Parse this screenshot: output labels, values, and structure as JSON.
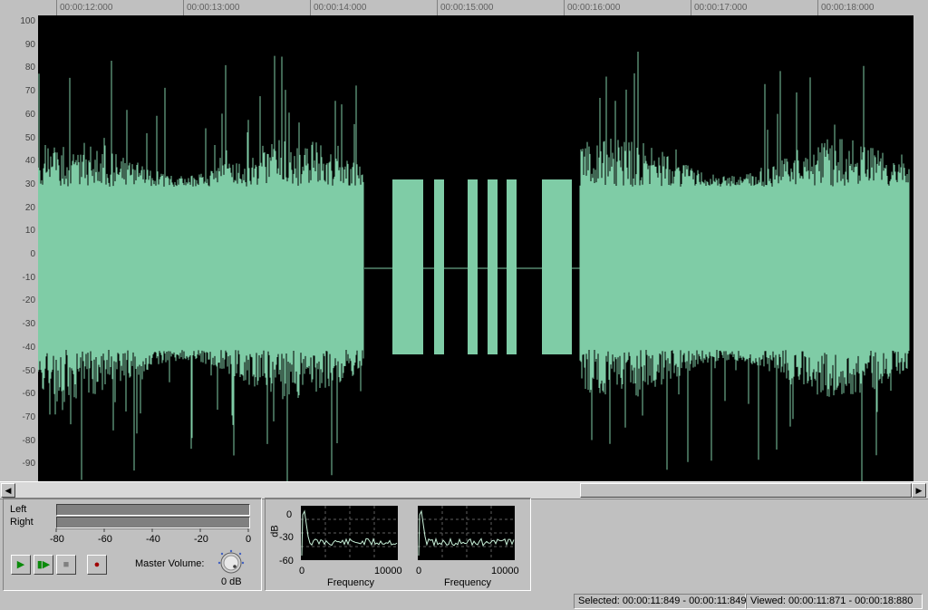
{
  "ruler": {
    "times": [
      "00:00:12:000",
      "00:00:13:000",
      "00:00:14:000",
      "00:00:15:000",
      "00:00:16:000",
      "00:00:17:000",
      "00:00:18:000"
    ]
  },
  "yaxis": {
    "labels": [
      "100",
      "90",
      "80",
      "70",
      "60",
      "50",
      "40",
      "30",
      "20",
      "10",
      "0",
      "-10",
      "-20",
      "-30",
      "-40",
      "-50",
      "-60",
      "-70",
      "-80",
      "-90"
    ]
  },
  "colors": {
    "waveform": "#7fcca6",
    "plot_background": "#000000",
    "scope_line": "#c8f0d8"
  },
  "levels": {
    "left_label": "Left",
    "right_label": "Right",
    "scale": [
      "-80",
      "-60",
      "-40",
      "-20",
      "0"
    ]
  },
  "transport": {
    "play_icon": "play-icon",
    "play_loop_icon": "play-loop-icon",
    "stop_icon": "stop-icon",
    "record_icon": "record-icon",
    "master_volume_label": "Master Volume:",
    "master_volume_value": "0 dB"
  },
  "spectrum": {
    "ylabel": "dB",
    "yticks": [
      "0",
      "-30",
      "-60"
    ],
    "xticks": [
      "0",
      "10000"
    ],
    "xlabel": "Frequency"
  },
  "status": {
    "selected": "Selected: 00:00:11:849 - 00:00:11:849",
    "viewed": "Viewed: 00:00:11:871 - 00:00:18:880"
  }
}
